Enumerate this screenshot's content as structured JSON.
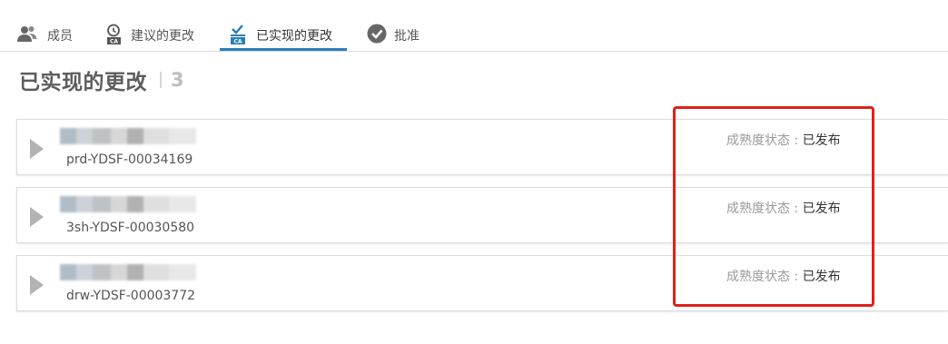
{
  "tabs": [
    {
      "label": "成员",
      "icon": "members-icon"
    },
    {
      "label": "建议的更改",
      "icon": "proposed-changes-icon"
    },
    {
      "label": "已实现的更改",
      "icon": "implemented-changes-icon",
      "active": true
    },
    {
      "label": "批准",
      "icon": "approval-check-icon"
    }
  ],
  "heading": {
    "title": "已实现的更改",
    "count": "3"
  },
  "items": [
    {
      "code": "prd-YDSF-00034169",
      "status_label": "成熟度状态 : ",
      "status_value": "已发布"
    },
    {
      "code": "3sh-YDSF-00030580",
      "status_label": "成熟度状态 : ",
      "status_value": "已发布"
    },
    {
      "code": "drw-YDSF-00003772",
      "status_label": "成熟度状态 : ",
      "status_value": "已发布"
    }
  ],
  "colors": {
    "accent": "#2b7db8",
    "highlight": "#e0201a"
  }
}
